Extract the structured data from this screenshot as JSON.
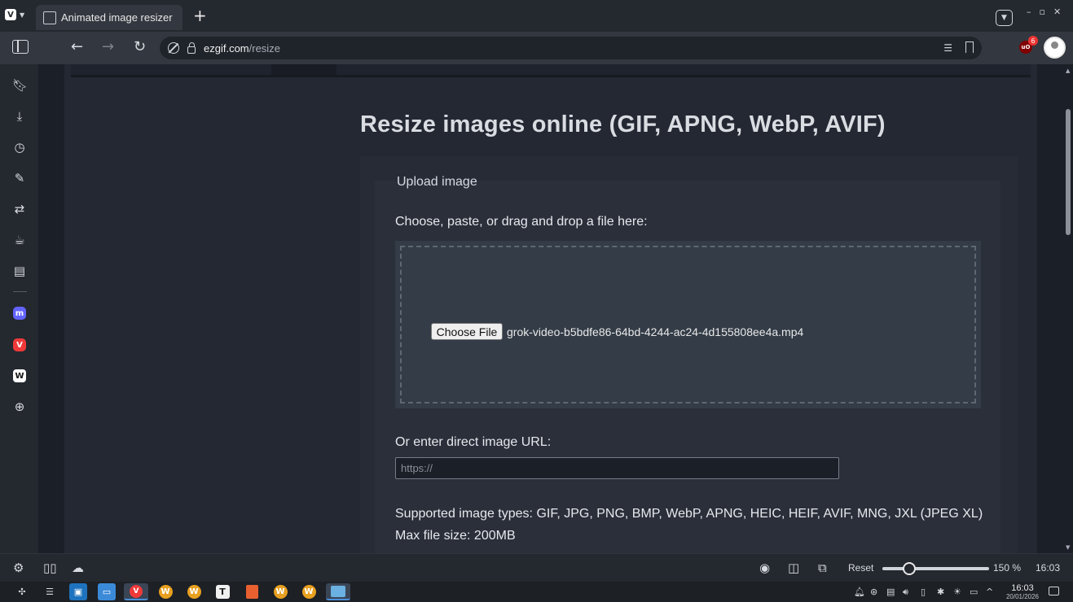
{
  "browser": {
    "tab_title": "Animated image resizer",
    "new_tab_label": "+",
    "url_host": "ezgif.com",
    "url_path": "/resize",
    "extension_badge_count": "6",
    "window_controls": [
      "–",
      "▫",
      "✕"
    ]
  },
  "page": {
    "heading": "Resize images online (GIF, APNG, WebP, AVIF)",
    "upload_legend": "Upload image",
    "choose_label": "Choose, paste, or drag and drop a file here:",
    "choose_button": "Choose File",
    "selected_file": "grok-video-b5bdfe86-64bd-4244-ac24-4d155808ee4a.mp4",
    "url_label": "Or enter direct image URL:",
    "url_placeholder": "https://",
    "supported_types": "Supported image types: GIF, JPG, PNG, BMP, WebP, APNG, HEIC, HEIF, AVIF, MNG, JXL (JPEG XL)",
    "max_size": "Max file size: 200MB"
  },
  "statusbar": {
    "reset_label": "Reset",
    "zoom_level": "150 %",
    "zoom_fraction": 0.25,
    "clock": "16:03"
  },
  "taskbar": {
    "time": "16:03",
    "date": "20/01/2026"
  },
  "icons": {
    "sidebar": [
      "bookmarks-icon",
      "downloads-icon",
      "history-icon",
      "notes-icon",
      "translate-icon",
      "reading-list-icon",
      "window-panel-icon",
      "mastodon-icon",
      "vivaldi-icon",
      "wikipedia-icon",
      "add-panel-icon"
    ]
  },
  "colors": {
    "vivaldi_red": "#ef3939",
    "mastodon_purple": "#6364ff",
    "accent_blue": "#4a90d9"
  }
}
